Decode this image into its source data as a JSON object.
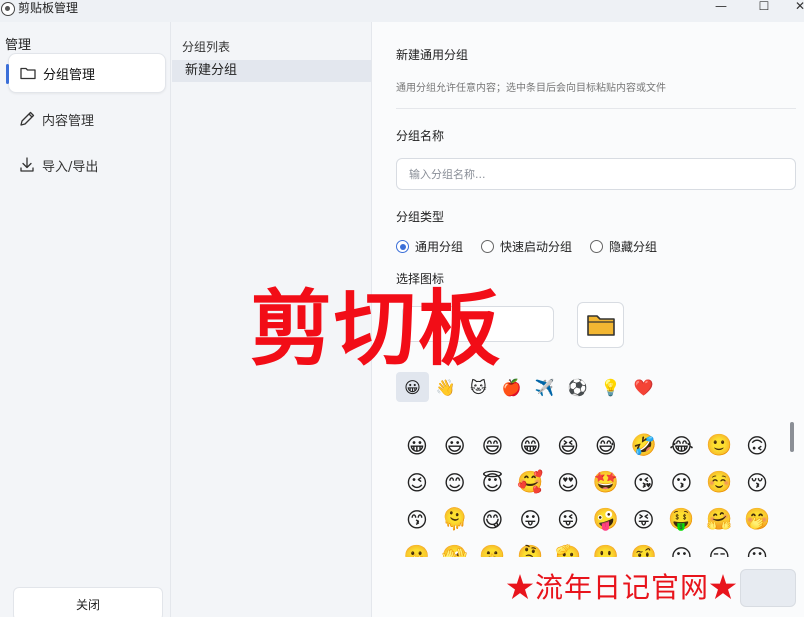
{
  "window": {
    "title": "剪贴板管理",
    "controls": [
      "—",
      "☐",
      "✕"
    ]
  },
  "sidebar": {
    "header": "管理",
    "items": [
      {
        "label": "分组管理",
        "icon": "folder-icon",
        "active": true
      },
      {
        "label": "内容管理",
        "icon": "pencil-icon",
        "active": false
      },
      {
        "label": "导入/导出",
        "icon": "download-icon",
        "active": false
      }
    ],
    "close_label": "关闭"
  },
  "groups": {
    "header": "分组列表",
    "items": [
      "新建分组"
    ]
  },
  "form": {
    "title": "新建通用分组",
    "description": "通用分组允许任意内容；选中条目后会向目标粘贴内容或文件",
    "name_label": "分组名称",
    "name_value": "",
    "name_placeholder": "输入分组名称...",
    "type_label": "分组类型",
    "type_options": [
      "通用分组",
      "快速启动分组",
      "隐藏分组"
    ],
    "type_selected": "通用分组",
    "icon_label": "选择图标",
    "icon_selected": "📁",
    "category_tabs": [
      "😀",
      "👋",
      "🐱",
      "🍎",
      "✈️",
      "⚽",
      "💡",
      "❤️"
    ],
    "emoji_rows": [
      [
        "😀",
        "😃",
        "😄",
        "😁",
        "😆",
        "😅",
        "🤣",
        "😂",
        "🙂",
        "🙃"
      ],
      [
        "😉",
        "😊",
        "😇",
        "🥰",
        "😍",
        "🤩",
        "😘",
        "😗",
        "☺️",
        "😚"
      ],
      [
        "😙",
        "🫠",
        "😋",
        "😛",
        "😜",
        "🤪",
        "😝",
        "🤑",
        "🤗",
        "🤭"
      ],
      [
        "🫢",
        "🫣",
        "🤫",
        "🤔",
        "🫡",
        "🤐",
        "🤨",
        "😐",
        "😑",
        "😶"
      ]
    ]
  },
  "overlay": {
    "title": "剪切板",
    "watermark": "★流年日记官网★"
  },
  "colors": {
    "accent": "#3b6fd8",
    "overlay_red": "#f20d17"
  }
}
